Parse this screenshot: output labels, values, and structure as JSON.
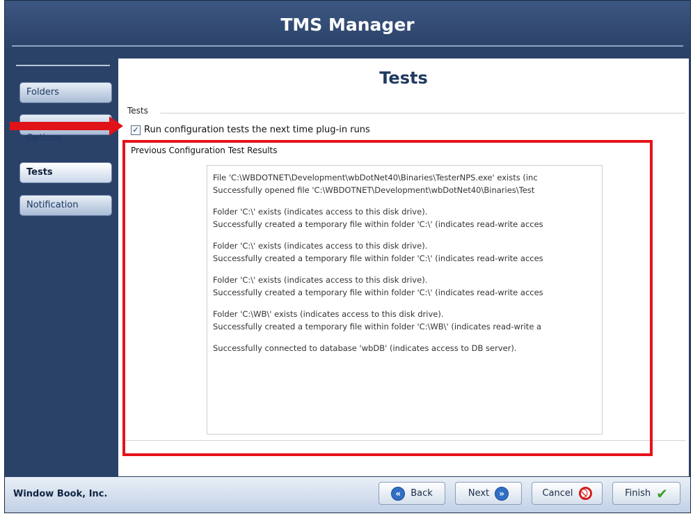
{
  "window": {
    "title": "TMS Manager"
  },
  "sidebar": {
    "items": [
      {
        "label": "Folders"
      },
      {
        "label": "Options"
      },
      {
        "label": "Tests"
      },
      {
        "label": "Notification"
      }
    ]
  },
  "panel": {
    "title": "Tests",
    "group_label": "Tests",
    "checkbox_label": "Run configuration tests the next time plug-in runs",
    "checkbox_checked": true,
    "results_label": "Previous Configuration Test Results",
    "results": [
      "File 'C:\\WBDOTNET\\Development\\wbDotNet40\\Binaries\\TesterNPS.exe' exists (inc",
      "Successfully opened file 'C:\\WBDOTNET\\Development\\wbDotNet40\\Binaries\\Test",
      "",
      "Folder 'C:\\' exists (indicates access to this disk drive).",
      "Successfully created a temporary file within folder 'C:\\' (indicates read-write acces",
      "",
      "Folder 'C:\\' exists (indicates access to this disk drive).",
      "Successfully created a temporary file within folder 'C:\\' (indicates read-write acces",
      "",
      "Folder 'C:\\' exists (indicates access to this disk drive).",
      "Successfully created a temporary file within folder 'C:\\' (indicates read-write acces",
      "",
      "Folder 'C:\\WB\\' exists (indicates access to this disk drive).",
      "Successfully created a temporary file within folder 'C:\\WB\\' (indicates read-write a",
      "",
      "Successfully connected to database 'wbDB' (indicates access to DB server)."
    ]
  },
  "footer": {
    "company": "Window Book, Inc.",
    "back": "Back",
    "next": "Next",
    "cancel": "Cancel",
    "finish": "Finish"
  },
  "annotation": {
    "highlight_color": "#e5131b"
  }
}
